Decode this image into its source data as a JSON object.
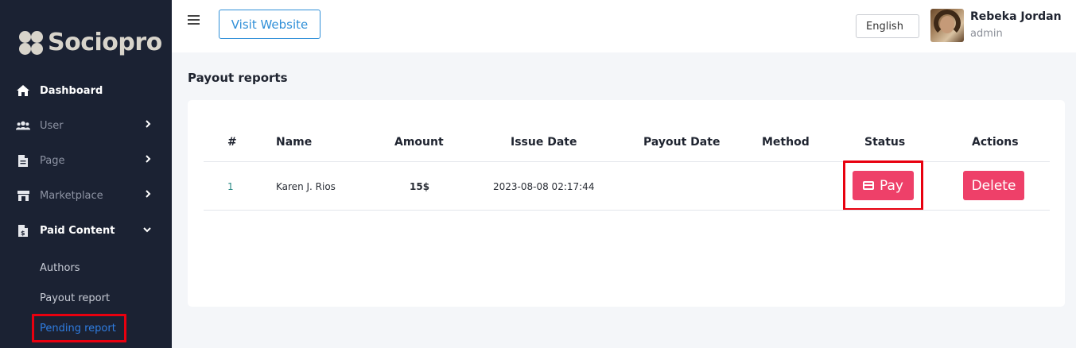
{
  "brand": {
    "name": "Sociopro"
  },
  "sidebar": {
    "items": [
      {
        "label": "Dashboard",
        "icon": "home-icon"
      },
      {
        "label": "User",
        "icon": "users-icon"
      },
      {
        "label": "Page",
        "icon": "file-icon"
      },
      {
        "label": "Marketplace",
        "icon": "store-icon"
      },
      {
        "label": "Paid Content",
        "icon": "paid-file-icon"
      }
    ],
    "sub_items": [
      "Authors",
      "Payout report",
      "Pending report"
    ]
  },
  "topbar": {
    "visit_label": "Visit Website",
    "language": "English",
    "user_name": "Rebeka Jordan",
    "user_role": "admin"
  },
  "main": {
    "title": "Payout reports",
    "table": {
      "headers": [
        "#",
        "Name",
        "Amount",
        "Issue Date",
        "Payout Date",
        "Method",
        "Status",
        "Actions"
      ],
      "rows": [
        {
          "index": "1",
          "name": "Karen J. Rios",
          "amount": "15$",
          "issue_date": "2023-08-08 02:17:44",
          "payout_date": "",
          "method": "",
          "status_button": "Pay",
          "action_button": "Delete"
        }
      ]
    }
  },
  "colors": {
    "sidebar_bg": "#1b2233",
    "accent_pink": "#ee4069",
    "link_blue": "#2f8fd8",
    "highlight_red": "#e8000f"
  }
}
